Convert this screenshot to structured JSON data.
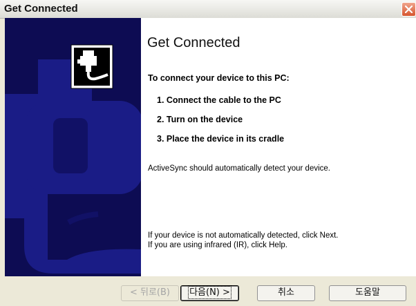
{
  "window": {
    "title": "Get Connected"
  },
  "content": {
    "heading": "Get Connected",
    "subheading": "To connect your device to this PC:",
    "steps": [
      "1. Connect the cable to the PC",
      "2. Turn on the device",
      "3. Place the device in its cradle"
    ],
    "detect_text": "ActiveSync should automatically detect your device.",
    "help_line1": "If your device is not automatically detected, click Next.",
    "help_line2": "If you are using infrared (IR), click Help."
  },
  "buttons": {
    "back": "< 뒤로(B)",
    "next": "다음(N) >",
    "cancel": "취소",
    "help": "도움말"
  },
  "colors": {
    "left_panel": "#0d0c53",
    "left_panel_shape": "#1a1c86",
    "close_button": "#d6562f"
  },
  "icons": [
    "close-icon",
    "cable-plug-icon"
  ]
}
